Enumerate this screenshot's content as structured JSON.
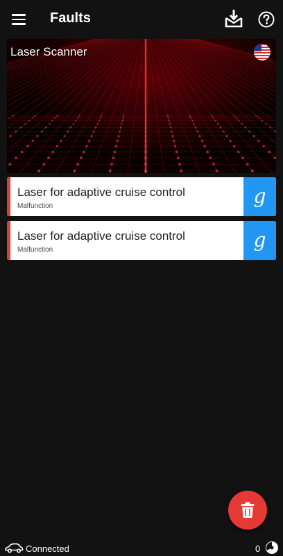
{
  "appbar": {
    "title": "Faults",
    "icons": {
      "menu": "menu-icon",
      "download": "download-icon",
      "help": "help-icon"
    }
  },
  "hero": {
    "title": "Laser Scanner",
    "flag_icon": "us-flag-icon",
    "colors": {
      "glow": "#8a0008"
    }
  },
  "faults": [
    {
      "name": "Laser for adaptive cruise control",
      "status": "Malfunction",
      "search_glyph": "g"
    },
    {
      "name": "Laser for adaptive cruise control",
      "status": "Malfunction",
      "search_glyph": "g"
    }
  ],
  "fab": {
    "icon": "trash-icon"
  },
  "status": {
    "connection": "Connected",
    "count": "0",
    "car_icon": "car-icon",
    "gauge_icon": "gauge-icon"
  },
  "colors": {
    "background": "#121212",
    "accent_red": "#e53935",
    "search_blue": "#2196f3",
    "card": "#ffffff"
  }
}
